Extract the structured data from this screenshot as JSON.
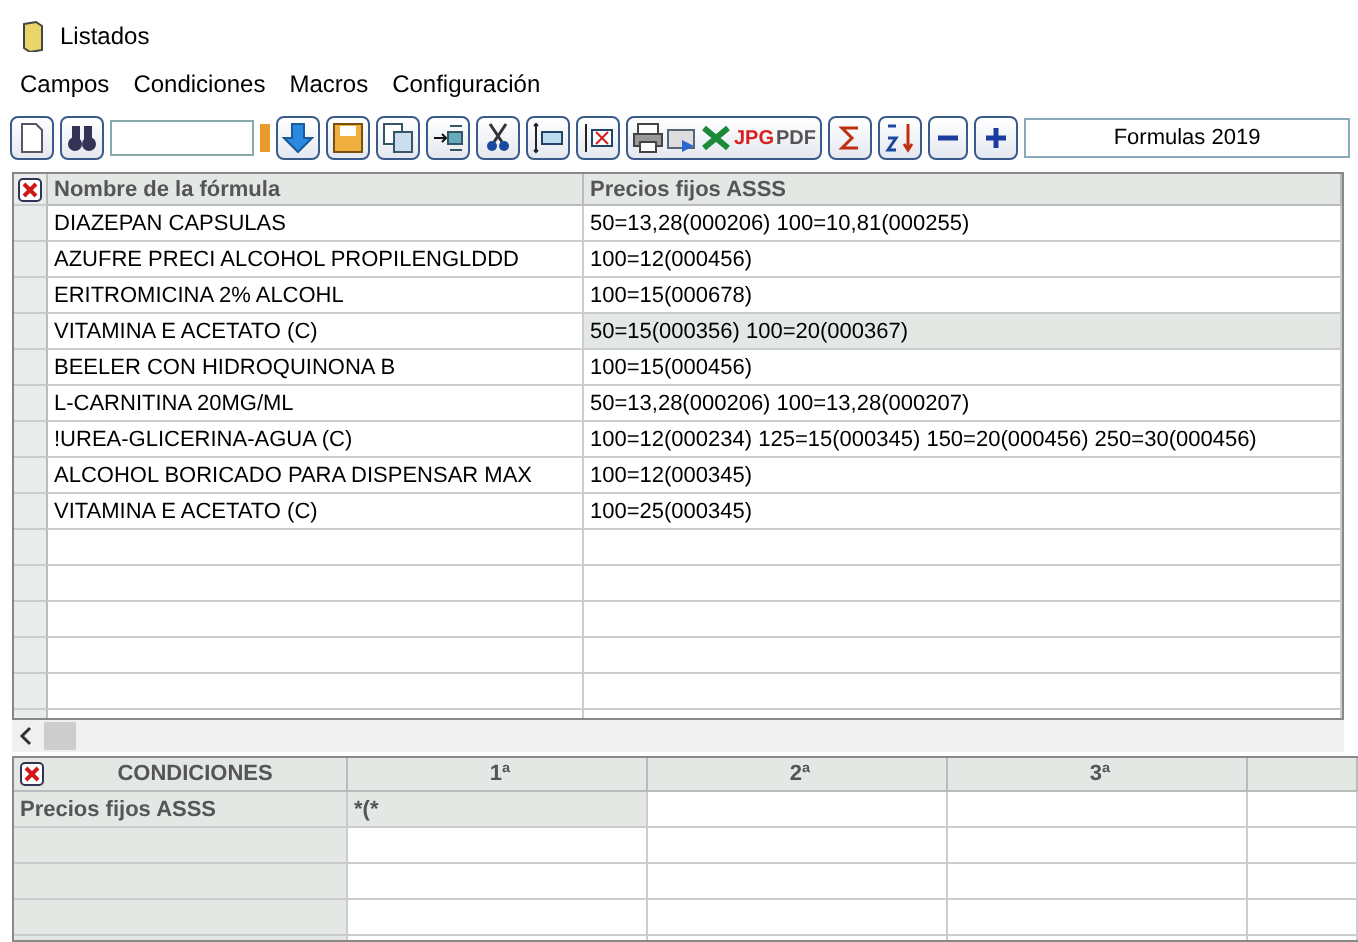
{
  "window": {
    "title": "Listados"
  },
  "menu": [
    "Campos",
    "Condiciones",
    "Macros",
    "Configuración"
  ],
  "toolbar": {
    "export_labels": [
      "JPG",
      "PDF"
    ],
    "preset": "Formulas 2019"
  },
  "table": {
    "columns": [
      "Nombre de la fórmula",
      "Precios fijos ASSS"
    ],
    "rows": [
      {
        "name": "DIAZEPAN CAPSULAS",
        "prices": "50=13,28(000206) 100=10,81(000255)",
        "selected": false
      },
      {
        "name": "AZUFRE PRECI ALCOHOL PROPILENGLDDD",
        "prices": "100=12(000456)",
        "selected": false
      },
      {
        "name": "ERITROMICINA 2% ALCOHL",
        "prices": "100=15(000678)",
        "selected": false
      },
      {
        "name": "VITAMINA E ACETATO (C)",
        "prices": "50=15(000356) 100=20(000367)",
        "selected": true
      },
      {
        "name": "BEELER CON HIDROQUINONA B",
        "prices": "100=15(000456)",
        "selected": false
      },
      {
        "name": "L-CARNITINA 20MG/ML",
        "prices": "50=13,28(000206) 100=13,28(000207)",
        "selected": false
      },
      {
        "name": "!UREA-GLICERINA-AGUA (C)",
        "prices": "100=12(000234) 125=15(000345) 150=20(000456) 250=30(000456)",
        "selected": false
      },
      {
        "name": "ALCOHOL BORICADO PARA DISPENSAR MAX",
        "prices": "100=12(000345)",
        "selected": false
      },
      {
        "name": "VITAMINA E ACETATO (C)",
        "prices": "100=25(000345)",
        "selected": false
      }
    ]
  },
  "conditions": {
    "columns": [
      "CONDICIONES",
      "1ª",
      "2ª",
      "3ª"
    ],
    "rows": [
      {
        "field": "Precios fijos ASSS",
        "values": [
          "*(*"
        ]
      }
    ]
  }
}
